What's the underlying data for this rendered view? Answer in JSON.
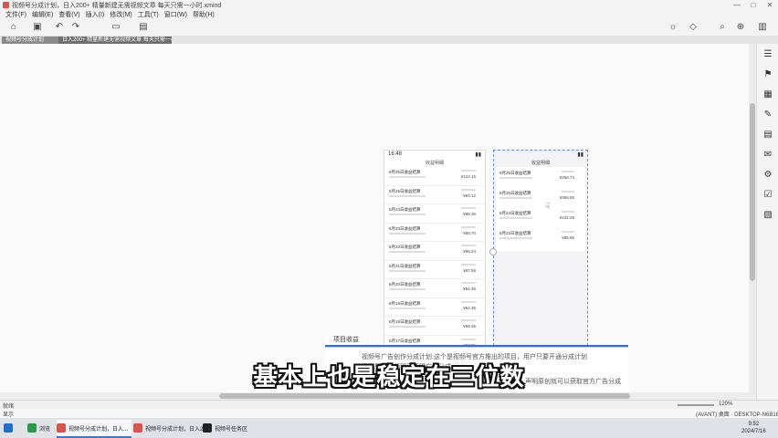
{
  "window": {
    "title": "视频号分成计划，日入200+ 精量新建无需视频文章 每天只需一小时.xmind",
    "controls": [
      "—",
      "□",
      "✕"
    ]
  },
  "menu": [
    "文件(F)",
    "编辑(E)",
    "查看(V)",
    "插入(I)",
    "修改(M)",
    "工具(T)",
    "窗口(W)",
    "帮助(H)"
  ],
  "toolbar": {
    "icons": [
      "home-icon",
      "save-icon",
      "undo-icon",
      "redo-icon",
      "layout-icon",
      "format-icon",
      "idea-icon",
      "shape-icon",
      "search-icon",
      "zoom-icon",
      "panel-icon"
    ]
  },
  "tabs": [
    {
      "label": "视频号分成计划"
    },
    {
      "label": "日入200+ 精量新建无需视频文章 每天只需一小时"
    }
  ],
  "phone1": {
    "time": "16:48",
    "header": "收益明细",
    "rows": [
      {
        "title": "6月25日收益结算",
        "amount": "¥124.15"
      },
      {
        "title": "6月25日收益结算",
        "amount": "¥94.12"
      },
      {
        "title": "6月24日收益结算",
        "amount": "¥98.36"
      },
      {
        "title": "6月23日收益结算",
        "amount": "¥98.70"
      },
      {
        "title": "6月22日收益结算",
        "amount": "¥98.24"
      },
      {
        "title": "6月21日收益结算",
        "amount": "¥87.56"
      },
      {
        "title": "6月20日收益结算",
        "amount": "¥94.36"
      },
      {
        "title": "6月19日收益结算",
        "amount": "¥64.35"
      },
      {
        "title": "6月18日收益结算",
        "amount": "¥68.35"
      },
      {
        "title": "6月17日收益结算",
        "amount": "¥87.36"
      }
    ]
  },
  "phone2": {
    "header": "收益明细",
    "rows": [
      {
        "title": "6月25日收益结算",
        "amount": "¥258.74"
      },
      {
        "title": "6月25日收益结算",
        "amount": "¥368.55"
      },
      {
        "title": "6月24日收益结算",
        "amount": "¥132.25"
      },
      {
        "title": "6月23日收益结算",
        "amount": "¥85.65"
      }
    ]
  },
  "mindmap": {
    "node_title": "项目收益",
    "line1": "视频号广告创作分成计划:这个是视频号官方推出的项目，用户只要开通分成计划",
    "line2": "发布原创视频即可获得广告分成",
    "line3": "稿，声明原创就可以获取官方广告分成"
  },
  "subtitle": "基本上也是稳定在三位数",
  "status": {
    "left": "就绪",
    "zoom": "120%"
  },
  "info": {
    "left": "显示",
    "right": "(AVANT) 桌面 · DESKTOP-N6B16LA"
  },
  "taskbar": {
    "items": [
      {
        "label": "浏览"
      },
      {
        "label": "视频号分成计划，日入..."
      },
      {
        "label": "视频号分成计划，日入20..."
      },
      {
        "label": "视频号任务区"
      }
    ],
    "time": "9:52",
    "date": "2024/7/16"
  }
}
